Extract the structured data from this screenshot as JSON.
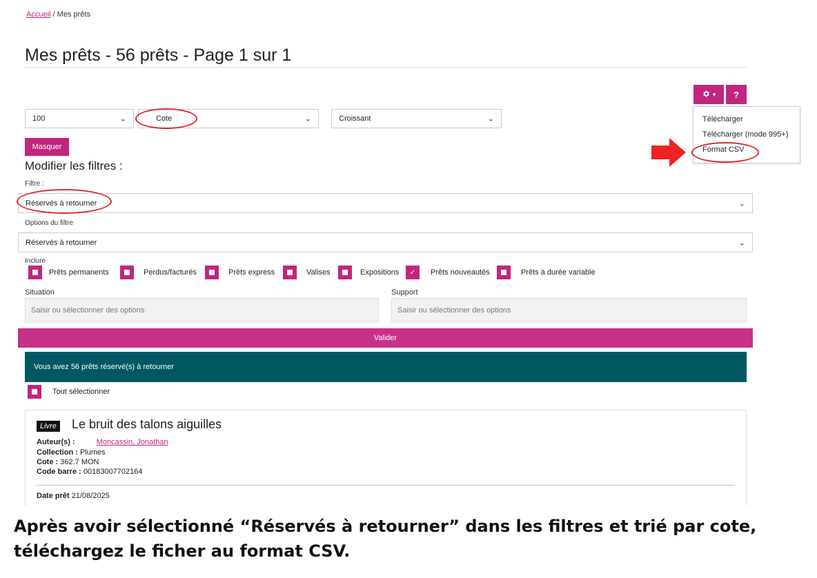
{
  "breadcrumb": {
    "home": "Accueil",
    "separator": "/",
    "current": "Mes prêts"
  },
  "page_title": "Mes prêts - 56 prêts - Page 1 sur 1",
  "toolbar": {
    "gear_icon": "gear-icon",
    "caret": "▾",
    "help_label": "?"
  },
  "download_menu": {
    "items": [
      "Télécharger",
      "Télécharger (mode 995+)",
      "Format CSV"
    ]
  },
  "sort": {
    "per_page": "100",
    "sort_by": "Cote",
    "order": "Croissant"
  },
  "masquer_label": "Masquer",
  "filters": {
    "heading": "Modifier les filtres :",
    "filter_label": "Filtre :",
    "filter_value": "Réservés à retourner",
    "options_label": "Options du filtre",
    "options_value": "Réservés à retourner",
    "include_label": "Inclure",
    "include_options": [
      {
        "label": "Prêts permanents",
        "checked": false
      },
      {
        "label": "Perdus/facturés",
        "checked": false
      },
      {
        "label": "Prêts express",
        "checked": false
      },
      {
        "label": "Valises",
        "checked": false
      },
      {
        "label": "Expositions",
        "checked": false
      },
      {
        "label": "Prêts nouveautés",
        "checked": true
      },
      {
        "label": "Prêts à durée variable",
        "checked": false
      }
    ],
    "situation_label": "Situation",
    "situation_placeholder": "Saisir ou sélectionner des options",
    "support_label": "Support",
    "support_placeholder": "Saisir ou sélectionner des options"
  },
  "valider_label": "Valider",
  "results_banner": "Vous avez 56 prêts réservé(s) à retourner",
  "select_all_label": "Tout sélectionner",
  "item": {
    "type_badge": "Livre",
    "title": "Le bruit des talons aiguilles",
    "author_label": "Auteur(s) :",
    "author": "Moncassin, Jonathan",
    "collection_label": "Collection :",
    "collection": "Plumes",
    "cote_label": "Cote :",
    "cote": "362.7 MON",
    "barcode_label": "Code barre :",
    "barcode": "00183007702164",
    "loan_date_label": "Date prêt",
    "loan_date": "21/08/2025"
  },
  "instruction": "Après avoir sélectionné “Réservés à retourner” dans les filtres et trié par cote, téléchargez le ficher au format CSV.",
  "colors": {
    "accent": "#c0267e",
    "banner": "#005962",
    "annotation": "#e02a2a"
  }
}
